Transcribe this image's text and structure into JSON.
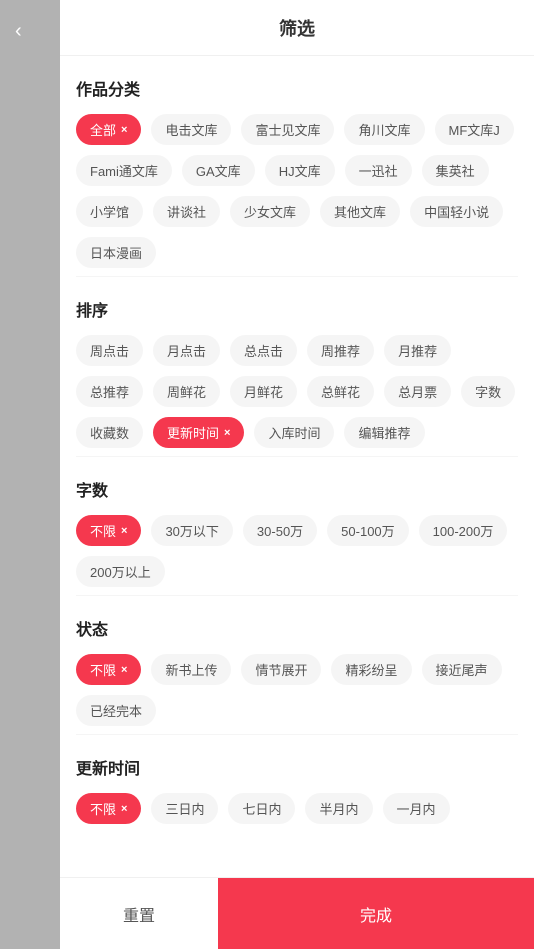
{
  "header": {
    "title": "筛选",
    "back_icon": "‹"
  },
  "sections": [
    {
      "id": "category",
      "title": "作品分类",
      "tags": [
        {
          "label": "全部",
          "active": true
        },
        {
          "label": "电击文库",
          "active": false
        },
        {
          "label": "富士见文库",
          "active": false
        },
        {
          "label": "角川文库",
          "active": false
        },
        {
          "label": "MF文库J",
          "active": false
        },
        {
          "label": "Fami通文库",
          "active": false
        },
        {
          "label": "GA文库",
          "active": false
        },
        {
          "label": "HJ文库",
          "active": false
        },
        {
          "label": "一迅社",
          "active": false
        },
        {
          "label": "集英社",
          "active": false
        },
        {
          "label": "小学馆",
          "active": false
        },
        {
          "label": "讲谈社",
          "active": false
        },
        {
          "label": "少女文库",
          "active": false
        },
        {
          "label": "其他文库",
          "active": false
        },
        {
          "label": "中国轻小说",
          "active": false
        },
        {
          "label": "日本漫画",
          "active": false
        }
      ]
    },
    {
      "id": "sort",
      "title": "排序",
      "tags": [
        {
          "label": "周点击",
          "active": false
        },
        {
          "label": "月点击",
          "active": false
        },
        {
          "label": "总点击",
          "active": false
        },
        {
          "label": "周推荐",
          "active": false
        },
        {
          "label": "月推荐",
          "active": false
        },
        {
          "label": "总推荐",
          "active": false
        },
        {
          "label": "周鲜花",
          "active": false
        },
        {
          "label": "月鲜花",
          "active": false
        },
        {
          "label": "总鲜花",
          "active": false
        },
        {
          "label": "总月票",
          "active": false
        },
        {
          "label": "字数",
          "active": false
        },
        {
          "label": "收藏数",
          "active": false
        },
        {
          "label": "更新时间",
          "active": true
        },
        {
          "label": "入库时间",
          "active": false
        },
        {
          "label": "编辑推荐",
          "active": false
        }
      ]
    },
    {
      "id": "wordcount",
      "title": "字数",
      "tags": [
        {
          "label": "不限",
          "active": true
        },
        {
          "label": "30万以下",
          "active": false
        },
        {
          "label": "30-50万",
          "active": false
        },
        {
          "label": "50-100万",
          "active": false
        },
        {
          "label": "100-200万",
          "active": false
        },
        {
          "label": "200万以上",
          "active": false
        }
      ]
    },
    {
      "id": "status",
      "title": "状态",
      "tags": [
        {
          "label": "不限",
          "active": true
        },
        {
          "label": "新书上传",
          "active": false
        },
        {
          "label": "情节展开",
          "active": false
        },
        {
          "label": "精彩纷呈",
          "active": false
        },
        {
          "label": "接近尾声",
          "active": false
        },
        {
          "label": "已经完本",
          "active": false
        }
      ]
    },
    {
      "id": "update-time",
      "title": "更新时间",
      "tags": [
        {
          "label": "不限",
          "active": true
        },
        {
          "label": "三日内",
          "active": false
        },
        {
          "label": "七日内",
          "active": false
        },
        {
          "label": "半月内",
          "active": false
        },
        {
          "label": "一月内",
          "active": false
        }
      ]
    }
  ],
  "footer": {
    "reset_label": "重置",
    "confirm_label": "完成"
  }
}
